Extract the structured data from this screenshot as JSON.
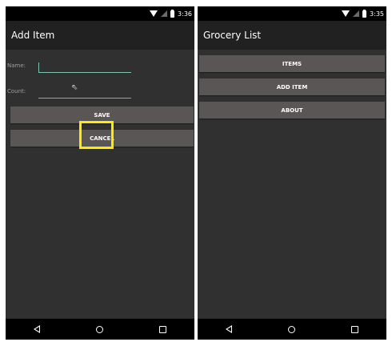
{
  "left_screen": {
    "status_bar": {
      "time": "3:36"
    },
    "app_bar": {
      "title": "Add Item"
    },
    "form": {
      "name_label": "Name:",
      "name_value": "",
      "count_label": "Count:",
      "count_value": ""
    },
    "buttons": {
      "save": "SAVE",
      "cancel": "CANCEL"
    },
    "highlight_color": "#ffeb00"
  },
  "right_screen": {
    "status_bar": {
      "time": "3:35"
    },
    "app_bar": {
      "title": "Grocery List"
    },
    "menu": [
      {
        "label": "ITEMS"
      },
      {
        "label": "ADD ITEM"
      },
      {
        "label": "ABOUT"
      }
    ]
  },
  "nav_bar": {
    "icons": [
      "back-icon",
      "home-icon",
      "recents-icon"
    ]
  },
  "colors": {
    "background": "#303030",
    "app_bar": "#212121",
    "button": "#5a5656",
    "accent": "#7fc3b0"
  }
}
